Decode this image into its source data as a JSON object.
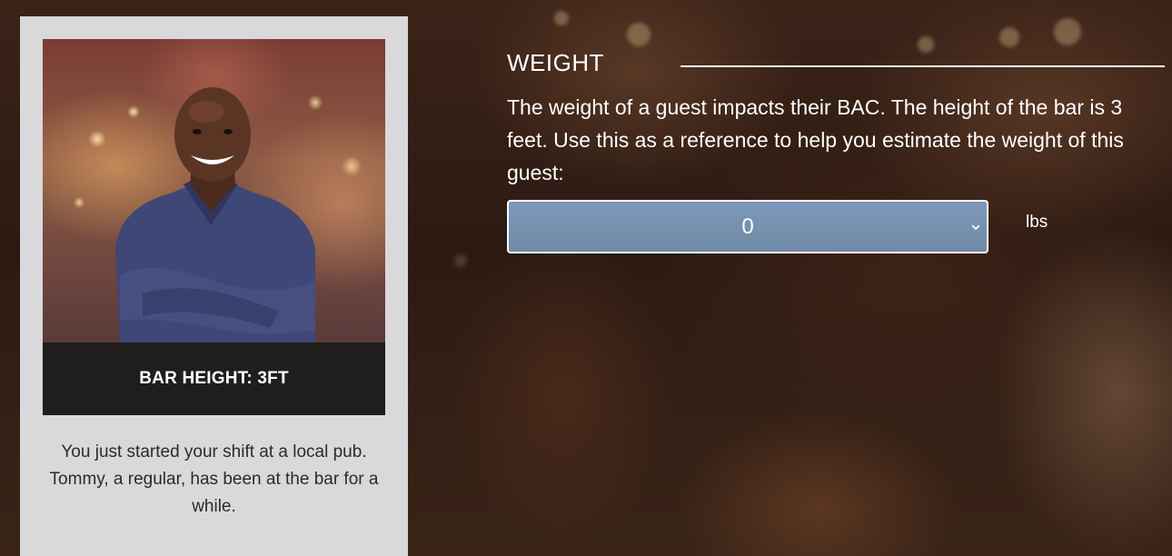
{
  "scenario_card": {
    "caption": "BAR HEIGHT: 3FT",
    "story": "You just started your shift at a local pub. Tommy, a regular, has been at the bar for a while."
  },
  "section": {
    "title": "WEIGHT",
    "description": "The weight of a guest impacts their BAC. The height of the bar is 3 feet. Use this as a reference to help you estimate the weight of this guest:"
  },
  "weight_select": {
    "selected_value": "0",
    "unit": "lbs"
  },
  "icons": {
    "dropdown": "chevron-down-icon"
  },
  "colors": {
    "select_fill": "#7891b0",
    "card_bg": "#d9d8da",
    "caption_bg": "#1f1e1c"
  }
}
